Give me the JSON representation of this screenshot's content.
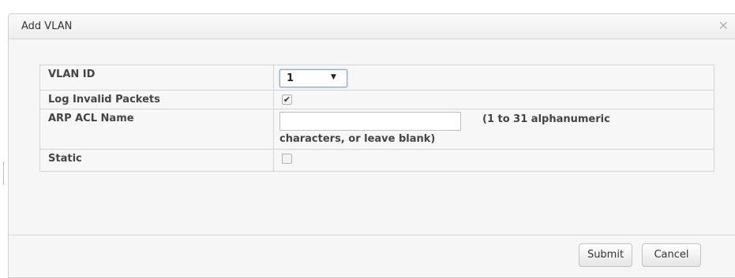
{
  "dialog": {
    "title": "Add VLAN",
    "close_icon": "close-icon"
  },
  "form": {
    "vlan_id": {
      "label": "VLAN ID",
      "value": "1",
      "dropdown_icon": "chevron-down-icon"
    },
    "log_invalid_packets": {
      "label": "Log Invalid Packets",
      "checked": true
    },
    "arp_acl_name": {
      "label": "ARP ACL Name",
      "value": "",
      "hint_line1": "(1 to 31 alphanumeric",
      "hint_line2": "characters, or leave blank)"
    },
    "static": {
      "label": "Static",
      "checked": false
    }
  },
  "buttons": {
    "submit": "Submit",
    "cancel": "Cancel"
  }
}
